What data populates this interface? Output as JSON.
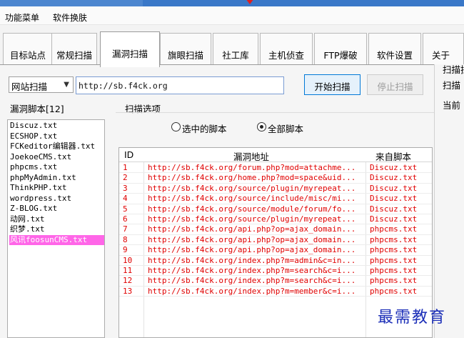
{
  "menubar": {
    "items": [
      "功能菜单",
      "软件换肤"
    ]
  },
  "tabs": [
    {
      "label": "目标站点",
      "active": false
    },
    {
      "label": "常规扫描",
      "active": false
    },
    {
      "label": "漏洞扫描",
      "active": true
    },
    {
      "label": "旗眼扫描",
      "active": false
    },
    {
      "label": "社工库",
      "active": false
    },
    {
      "label": "主机侦查",
      "active": false
    },
    {
      "label": "FTP爆破",
      "active": false
    },
    {
      "label": "软件设置",
      "active": false
    },
    {
      "label": "关于",
      "active": false
    }
  ],
  "scan_bar": {
    "mode_select": "网站扫描",
    "url_value": "http://sb.f4ck.org",
    "start_button": "开始扫描",
    "stop_button": "停止扫描"
  },
  "side_panel": {
    "lines": [
      "扫描拉",
      "扫描",
      "当前"
    ]
  },
  "scripts_panel": {
    "title": "漏洞脚本[12]",
    "items": [
      "Discuz.txt",
      "ECSHOP.txt",
      "FCKeditor编辑器.txt",
      "JoekoeCMS.txt",
      "phpcms.txt",
      "phpMyAdmin.txt",
      "ThinkPHP.txt",
      "wordpress.txt",
      "Z-BLOG.txt",
      "动网.txt",
      "织梦.txt",
      "风讯foosunCMS.txt"
    ],
    "selected_index": 11
  },
  "scan_options": {
    "title": "扫描选项",
    "radio_selected_label": "选中的脚本",
    "radio_all_label": "全部脚本",
    "all_checked": true
  },
  "results": {
    "columns": [
      "ID",
      "漏洞地址",
      "来自脚本"
    ],
    "rows": [
      {
        "id": "1",
        "url": "http://sb.f4ck.org/forum.php?mod=attachme...",
        "script": "Discuz.txt"
      },
      {
        "id": "2",
        "url": "http://sb.f4ck.org/home.php?mod=space&uid...",
        "script": "Discuz.txt"
      },
      {
        "id": "3",
        "url": "http://sb.f4ck.org/source/plugin/myrepeat...",
        "script": "Discuz.txt"
      },
      {
        "id": "4",
        "url": "http://sb.f4ck.org/source/include/misc/mi...",
        "script": "Discuz.txt"
      },
      {
        "id": "5",
        "url": "http://sb.f4ck.org/source/module/forum/fo...",
        "script": "Discuz.txt"
      },
      {
        "id": "6",
        "url": "http://sb.f4ck.org/source/plugin/myrepeat...",
        "script": "Discuz.txt"
      },
      {
        "id": "7",
        "url": "http://sb.f4ck.org/api.php?op=ajax_domain...",
        "script": "phpcms.txt"
      },
      {
        "id": "8",
        "url": "http://sb.f4ck.org/api.php?op=ajax_domain...",
        "script": "phpcms.txt"
      },
      {
        "id": "9",
        "url": "http://sb.f4ck.org/api.php?op=ajax_domain...",
        "script": "phpcms.txt"
      },
      {
        "id": "10",
        "url": "http://sb.f4ck.org/index.php?m=admin&c=in...",
        "script": "phpcms.txt"
      },
      {
        "id": "11",
        "url": "http://sb.f4ck.org/index.php?m=search&c=i...",
        "script": "phpcms.txt"
      },
      {
        "id": "12",
        "url": "http://sb.f4ck.org/index.php?m=search&c=i...",
        "script": "phpcms.txt"
      },
      {
        "id": "13",
        "url": "http://sb.f4ck.org/index.php?m=member&c=i...",
        "script": "phpcms.txt"
      }
    ]
  },
  "watermark": "最需教育",
  "colors": {
    "accent": "#0078d7",
    "result_text": "#e00000",
    "selected_item": "#ff66e8",
    "watermark": "#1c2fb8"
  }
}
